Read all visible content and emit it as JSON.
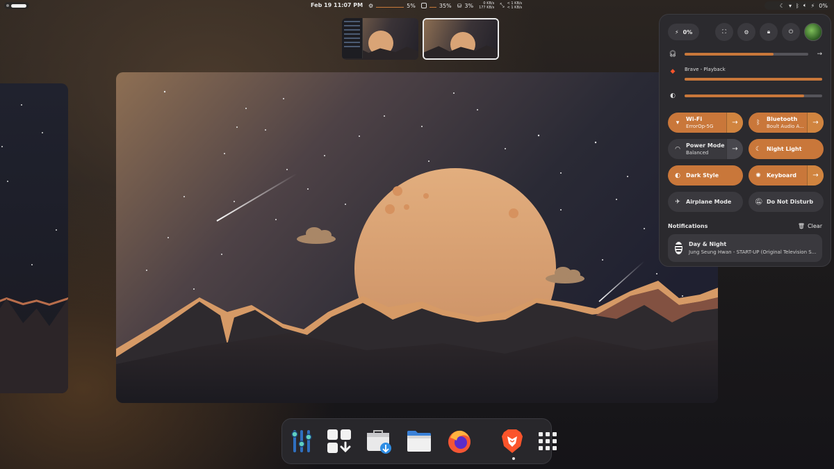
{
  "topbar": {
    "clock": "Feb 19  11:07 PM",
    "cpu": "5%",
    "memory": "35%",
    "disk": "3%",
    "net_up": "0 KB/s",
    "net_down": "177 KB/s",
    "net2_up": "< 1 KB/s",
    "net2_down": "< 1 KB/s",
    "battery": "0%"
  },
  "quick_settings": {
    "battery_label": "0%",
    "volume_level": 0.72,
    "media_label": "Brave - Playback",
    "media_level": 1.0,
    "brightness_level": 0.87,
    "toggles": [
      {
        "title": "Wi-Fi",
        "subtitle": "ErrorOp-5G",
        "on": true
      },
      {
        "title": "Bluetooth",
        "subtitle": "Boult Audio A...",
        "on": true
      },
      {
        "title": "Power Mode",
        "subtitle": "Balanced",
        "on": false
      },
      {
        "title": "Night Light",
        "subtitle": "",
        "on": true
      },
      {
        "title": "Dark Style",
        "subtitle": "",
        "on": true
      },
      {
        "title": "Keyboard",
        "subtitle": "",
        "on": true
      },
      {
        "title": "Airplane Mode",
        "subtitle": "",
        "on": false
      },
      {
        "title": "Do Not Disturb",
        "subtitle": "",
        "on": false
      }
    ],
    "notifications_title": "Notifications",
    "clear_label": "Clear",
    "notification": {
      "title": "Day & Night",
      "body": "Jung Seung Hwan - START-UP (Original Television S..."
    }
  },
  "dock": {
    "apps": [
      "tweaks-icon",
      "software-updater-icon",
      "store-download-icon",
      "files-icon",
      "firefox-icon",
      "brave-icon",
      "app-grid-icon"
    ]
  },
  "colors": {
    "accent": "#c9773a",
    "panel": "#2b2a2e",
    "moon": "#d9a476"
  }
}
